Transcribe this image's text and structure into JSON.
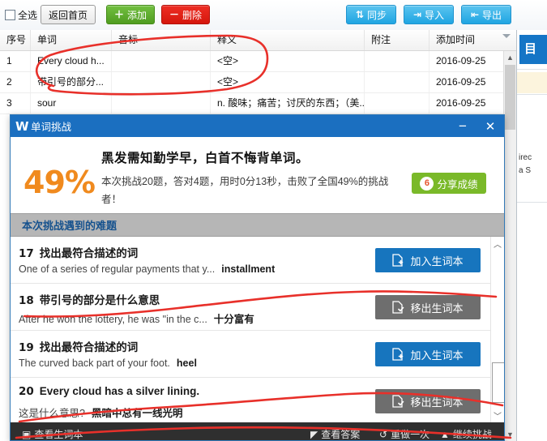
{
  "background_app": {
    "toolbar": {
      "select_all_label": "全选",
      "home_label": "返回首页",
      "add_label": "添加",
      "add_icon": "plus-icon",
      "delete_label": "删除",
      "delete_icon": "minus-icon",
      "sync_label": "同步",
      "sync_icon": "sync-arrows-icon",
      "import_label": "导入",
      "import_icon": "import-arrow-icon",
      "export_label": "导出",
      "export_icon": "export-arrow-icon"
    },
    "table": {
      "columns": [
        "序号",
        "单词",
        "音标",
        "释义",
        "附注",
        "添加时间"
      ],
      "rows": [
        {
          "no": "1",
          "word": "Every cloud h...",
          "phonetic": "",
          "meaning": "<空>",
          "note": "",
          "added": "2016-09-25"
        },
        {
          "no": "2",
          "word": "带引号的部分...",
          "phonetic": "",
          "meaning": "<空>",
          "note": "",
          "added": "2016-09-25"
        },
        {
          "no": "3",
          "word": "sour",
          "phonetic": "",
          "meaning": "n. 酸味；痛苦；讨厌的东西；（美...",
          "note": "",
          "added": "2016-09-25"
        }
      ]
    },
    "right_panel": {
      "badge_glyph": "目",
      "text_line_1": "irec",
      "text_line_2": "a S"
    },
    "scrollbar": {
      "up_arrow": "▲",
      "down_arrow": "▼"
    }
  },
  "dialog": {
    "title": "单词挑战",
    "logo": "W",
    "minimize_label": "−",
    "close_label": "✕",
    "hero": {
      "slogan": "黑发需知勤学早，白首不悔背单词。",
      "percent": "49%",
      "description": "本次挑战20题，答对4题，用时0分13秒，击败了全国49%的挑战者！",
      "share_label": "分享成绩",
      "share_icon": "weibo-icon",
      "share_icon_glyph": "6"
    },
    "section_title": "本次挑战遇到的难题",
    "questions": [
      {
        "number": "17",
        "title": "找出最符合描述的词",
        "prompt": "One of a series of regular payments that y...",
        "answer": "installment",
        "button_label": "加入生词本",
        "button_state": "add",
        "button_icon": "add-to-wordbook-icon"
      },
      {
        "number": "18",
        "title": "带引号的部分是什么意思",
        "prompt": "After he won the lottery, he was \"in the c...",
        "answer": "十分富有",
        "button_label": "移出生词本",
        "button_state": "remove",
        "button_icon": "remove-from-wordbook-icon"
      },
      {
        "number": "19",
        "title": "找出最符合描述的词",
        "prompt": "The curved back part of your foot.",
        "answer": "heel",
        "button_label": "加入生词本",
        "button_state": "add",
        "button_icon": "add-to-wordbook-icon"
      },
      {
        "number": "20",
        "title": "Every cloud has a silver lining.",
        "prompt": "这是什么意思?",
        "answer": "黑暗中总有一线光明",
        "button_label": "移出生词本",
        "button_state": "remove",
        "button_icon": "remove-from-wordbook-icon"
      }
    ],
    "scrollbar": {
      "up_arrow": "︿",
      "down_arrow": "﹀"
    },
    "footer": {
      "wordbook_label": "查看生词本",
      "wordbook_icon": "book-icon",
      "answers_label": "查看答案",
      "answers_icon": "flag-icon",
      "redo_label": "重做一次",
      "redo_icon": "redo-icon",
      "continue_label": "继续挑战",
      "continue_icon": "play-icon"
    }
  },
  "colors": {
    "dialog_title_blue": "#1b6fc0",
    "accent_orange": "#f08a1e",
    "share_green": "#7ab929",
    "button_blue": "#1775be",
    "button_grey": "#6e6e6e",
    "section_grey": "#b6b6b6",
    "annotation_red": "#e8302a"
  }
}
